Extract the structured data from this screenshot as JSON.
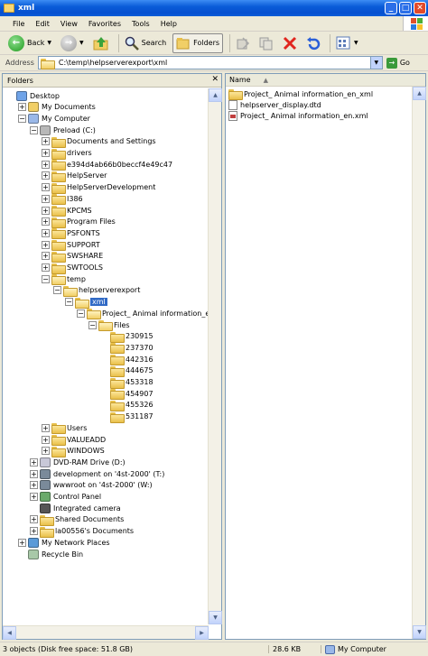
{
  "window": {
    "title": "xml"
  },
  "menu": [
    "File",
    "Edit",
    "View",
    "Favorites",
    "Tools",
    "Help"
  ],
  "toolbar": {
    "back_label": "Back",
    "search_label": "Search",
    "folders_label": "Folders"
  },
  "address": {
    "label": "Address",
    "value": "C:\\temp\\helpserverexport\\xml",
    "go_label": "Go"
  },
  "folders_pane": {
    "title": "Folders",
    "tree": [
      {
        "label": "Desktop",
        "icon": "desktop-icon"
      },
      {
        "label": "My Documents",
        "icon": "my-documents-icon"
      },
      {
        "label": "My Computer",
        "icon": "my-computer-icon"
      },
      {
        "label": "Preload (C:)",
        "icon": "drive-icon"
      },
      {
        "label": "Documents and Settings",
        "icon": "folder-icon"
      },
      {
        "label": "drivers",
        "icon": "folder-icon"
      },
      {
        "label": "e394d4ab66b0beccf4e49c47",
        "icon": "folder-icon"
      },
      {
        "label": "HelpServer",
        "icon": "folder-icon"
      },
      {
        "label": "HelpServerDevelopment",
        "icon": "folder-icon"
      },
      {
        "label": "I386",
        "icon": "folder-icon"
      },
      {
        "label": "KPCMS",
        "icon": "folder-icon"
      },
      {
        "label": "Program Files",
        "icon": "folder-icon"
      },
      {
        "label": "PSFONTS",
        "icon": "folder-icon"
      },
      {
        "label": "SUPPORT",
        "icon": "folder-icon"
      },
      {
        "label": "SWSHARE",
        "icon": "folder-icon"
      },
      {
        "label": "SWTOOLS",
        "icon": "folder-icon"
      },
      {
        "label": "temp",
        "icon": "folder-open-icon"
      },
      {
        "label": "helpserverexport",
        "icon": "folder-open-icon"
      },
      {
        "label": "xml",
        "icon": "folder-open-icon"
      },
      {
        "label": "Project_ Animal information_en_xml",
        "icon": "folder-open-icon"
      },
      {
        "label": "Files",
        "icon": "folder-open-icon"
      },
      {
        "label": "230915",
        "icon": "folder-icon"
      },
      {
        "label": "237370",
        "icon": "folder-icon"
      },
      {
        "label": "442316",
        "icon": "folder-icon"
      },
      {
        "label": "444675",
        "icon": "folder-icon"
      },
      {
        "label": "453318",
        "icon": "folder-icon"
      },
      {
        "label": "454907",
        "icon": "folder-icon"
      },
      {
        "label": "455326",
        "icon": "folder-icon"
      },
      {
        "label": "531187",
        "icon": "folder-icon"
      },
      {
        "label": "Users",
        "icon": "folder-icon"
      },
      {
        "label": "VALUEADD",
        "icon": "folder-icon"
      },
      {
        "label": "WINDOWS",
        "icon": "folder-icon"
      },
      {
        "label": "DVD-RAM Drive (D:)",
        "icon": "dvd-drive-icon"
      },
      {
        "label": "development on '4st-2000' (T:)",
        "icon": "network-drive-icon"
      },
      {
        "label": "wwwroot on '4st-2000' (W:)",
        "icon": "network-drive-icon"
      },
      {
        "label": "Control Panel",
        "icon": "control-panel-icon"
      },
      {
        "label": "Integrated camera",
        "icon": "camera-icon"
      },
      {
        "label": "Shared Documents",
        "icon": "folder-icon"
      },
      {
        "label": "la00556's Documents",
        "icon": "folder-icon"
      },
      {
        "label": "My Network Places",
        "icon": "network-places-icon"
      },
      {
        "label": "Recycle Bin",
        "icon": "recycle-bin-icon"
      }
    ]
  },
  "files_pane": {
    "column_name": "Name",
    "items": [
      {
        "label": "Project_ Animal information_en_xml",
        "icon": "folder-icon"
      },
      {
        "label": "helpserver_display.dtd",
        "icon": "dtd-file-icon"
      },
      {
        "label": "Project_ Animal information_en.xml",
        "icon": "xml-file-icon"
      }
    ]
  },
  "status": {
    "objects": "3 objects (Disk free space: 51.8 GB)",
    "size": "28.6 KB",
    "location": "My Computer"
  },
  "colors": {
    "title_blue": "#0A5CD8",
    "selection": "#316AC5",
    "chrome": "#ECE9D8"
  }
}
